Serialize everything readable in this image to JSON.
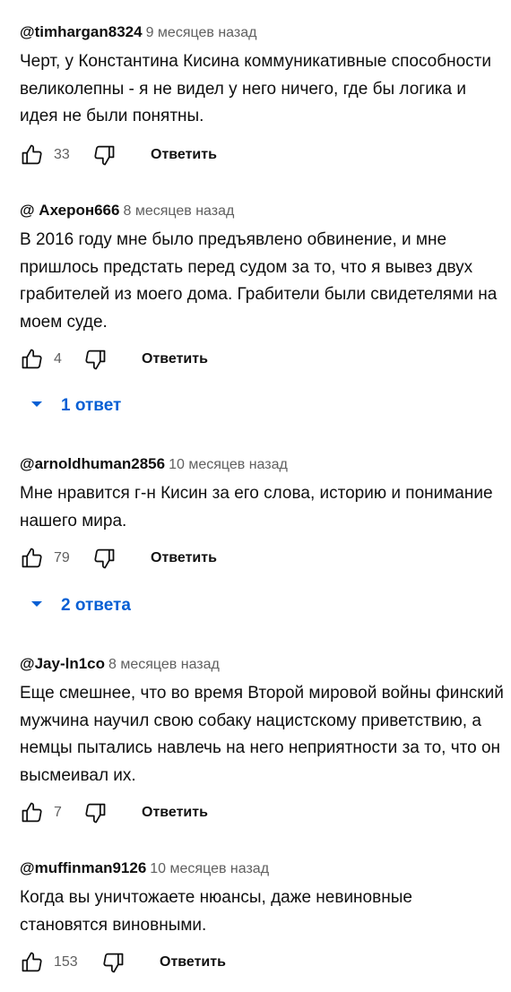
{
  "comments": [
    {
      "author": "@timhargan8324",
      "time": "9 месяцев назад",
      "text": "Черт, у Константина Кисина коммуникативные способности великолепны - я не видел у него ничего, где бы логика и идея не были понятны.",
      "likes": "33",
      "reply_label": "Ответить"
    },
    {
      "author": "@ Ахерон666",
      "time": "8 месяцев назад",
      "text": "В 2016 году мне было предъявлено обвинение, и мне пришлось предстать перед судом за то, что я вывез двух грабителей из моего дома. Грабители были свидетелями на моем суде.",
      "likes": "4",
      "reply_label": "Ответить",
      "replies_label": "1 ответ"
    },
    {
      "author": "@arnoldhuman2856",
      "time": "10 месяцев назад",
      "text": "Мне нравится г-н Кисин за его слова, историю и понимание нашего мира.",
      "likes": "79",
      "reply_label": "Ответить",
      "replies_label": "2 ответа"
    },
    {
      "author": "@Jay-ln1co",
      "time": "8 месяцев назад",
      "text": "Еще смешнее, что во время Второй мировой войны финский мужчина научил свою собаку нацистскому приветствию, а немцы пытались навлечь на него неприятности за то, что он высмеивал их.",
      "likes": "7",
      "reply_label": "Ответить"
    },
    {
      "author": "@muffinman9126",
      "time": "10 месяцев назад",
      "text": "Когда вы уничтожаете нюансы, даже невиновные становятся виновными.",
      "likes": "153",
      "reply_label": "Ответить"
    }
  ],
  "icons": {
    "like": "thumb-up-icon",
    "dislike": "thumb-down-icon",
    "expand": "chevron-down-icon"
  },
  "colors": {
    "text": "#0f0f0f",
    "secondary": "#606060",
    "link": "#065fd4"
  }
}
